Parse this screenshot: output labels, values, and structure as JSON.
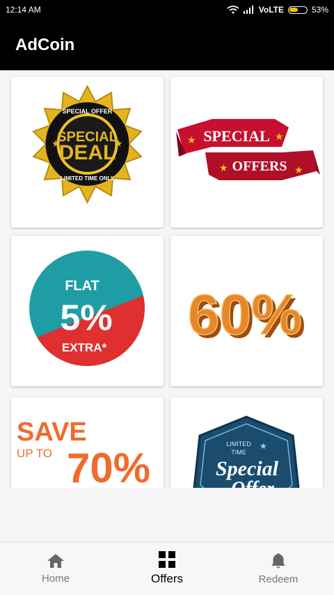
{
  "status_bar": {
    "time": "12:14 AM",
    "network": "VoLTE",
    "battery": "53%"
  },
  "app_bar": {
    "title": "AdCoin"
  },
  "offers": [
    {
      "badge_top": "SPECIAL OFFER",
      "line1": "SPECIAL",
      "line2": "DEAL",
      "badge_bottom": "LIMITED TIME ONLY",
      "colors": {
        "gold": "#e4b41f",
        "dark": "#111111"
      }
    },
    {
      "line1": "SPECIAL",
      "line2": "OFFERS",
      "colors": {
        "red": "#c8102e",
        "star": "#f2c81b"
      }
    },
    {
      "line1": "FLAT",
      "line2": "5%",
      "line3": "EXTRA*",
      "colors": {
        "teal": "#1e9da4",
        "red": "#e02f2f"
      }
    },
    {
      "line1": "60%",
      "colors": {
        "orange": "#e8862a"
      }
    },
    {
      "line1": "SAVE",
      "line2": "UP TO",
      "line3": "70%",
      "colors": {
        "orange": "#f06b2d"
      }
    },
    {
      "line1": "LIMITED",
      "line2": "TIME",
      "line3": "Special",
      "line4": "Offer",
      "colors": {
        "navy": "#1a4c6e"
      }
    }
  ],
  "bottom_nav": {
    "items": [
      {
        "label": "Home",
        "icon": "home-icon",
        "active": false
      },
      {
        "label": "Offers",
        "icon": "grid-icon",
        "active": true
      },
      {
        "label": "Redeem",
        "icon": "bell-icon",
        "active": false
      }
    ]
  }
}
